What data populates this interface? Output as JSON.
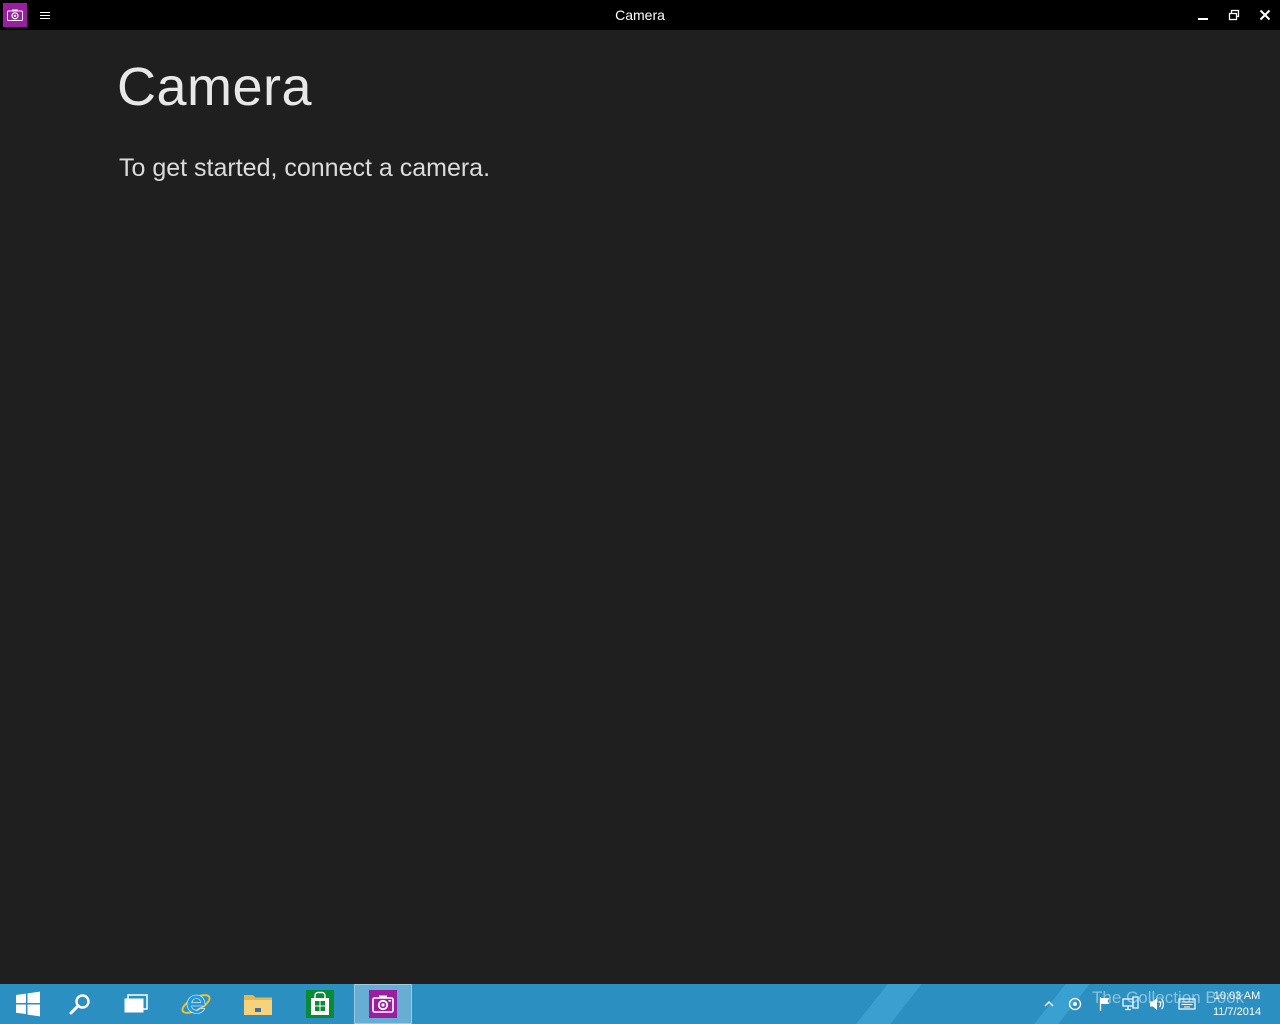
{
  "window": {
    "title": "Camera"
  },
  "main": {
    "heading": "Camera",
    "message": "To get started, connect a camera."
  },
  "taskbar": {
    "items": [
      {
        "name": "start",
        "icon": "windows-logo-icon"
      },
      {
        "name": "search",
        "icon": "search-icon"
      },
      {
        "name": "task-view",
        "icon": "task-view-icon"
      },
      {
        "name": "internet-explorer",
        "icon": "internet-explorer-icon"
      },
      {
        "name": "file-explorer",
        "icon": "folder-icon"
      },
      {
        "name": "store",
        "icon": "store-icon"
      },
      {
        "name": "camera",
        "icon": "camera-icon",
        "active": true
      }
    ],
    "watermark": "The Collection Book",
    "clock": {
      "time": "10:03 AM",
      "date": "11/7/2014"
    }
  },
  "colors": {
    "titlebar": "#000000",
    "background": "#1f1f1f",
    "taskbar": "#2b8fc2",
    "camera_accent": "#9b1ea0",
    "store_green": "#0b8a36"
  }
}
